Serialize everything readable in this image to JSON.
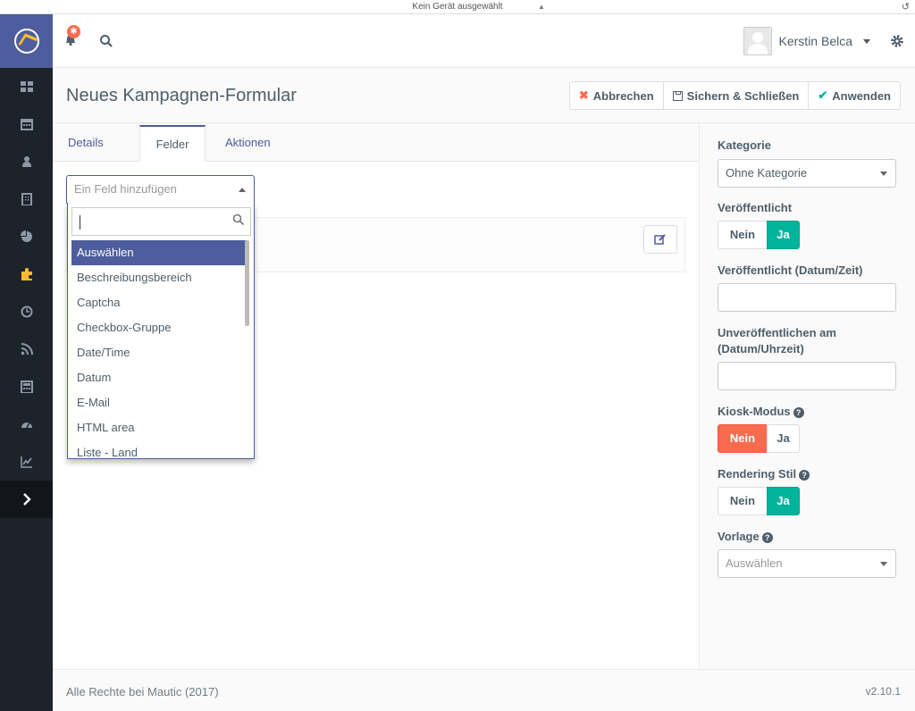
{
  "device_bar": {
    "label": "Kein Gerät ausgewählt"
  },
  "topbar": {
    "user_name": "Kerstin Belca",
    "notification_badge": "✱"
  },
  "header": {
    "title": "Neues Kampagnen-Formular",
    "buttons": {
      "cancel": "Abbrechen",
      "save_close": "Sichern & Schließen",
      "apply": "Anwenden"
    }
  },
  "tabs": {
    "details": "Details",
    "fields": "Felder",
    "actions": "Aktionen"
  },
  "field_select": {
    "placeholder": "Ein Feld hinzufügen",
    "options": [
      "Auswählen",
      "Beschreibungsbereich",
      "Captcha",
      "Checkbox-Gruppe",
      "Date/Time",
      "Datum",
      "E-Mail",
      "HTML area",
      "Liste - Land"
    ],
    "highlighted": "Auswählen"
  },
  "sidebar_panel": {
    "category": {
      "label": "Kategorie",
      "value": "Ohne Kategorie"
    },
    "published": {
      "label": "Veröffentlicht",
      "no": "Nein",
      "yes": "Ja",
      "selected": "Ja"
    },
    "publish_up": {
      "label": "Veröffentlicht (Datum/Zeit)",
      "value": ""
    },
    "publish_down": {
      "label_line1": "Unveröffentlichen am",
      "label_line2": "(Datum/Uhrzeit)",
      "value": ""
    },
    "kiosk": {
      "label": "Kiosk-Modus",
      "no": "Nein",
      "yes": "Ja",
      "selected": "Nein"
    },
    "render_style": {
      "label": "Rendering Stil",
      "no": "Nein",
      "yes": "Ja",
      "selected": "Ja"
    },
    "template": {
      "label": "Vorlage",
      "placeholder": "Auswählen"
    }
  },
  "footer": {
    "copyright": "Alle Rechte bei Mautic (2017)",
    "version": "v2.10.1"
  },
  "colors": {
    "brand": "#4e5d9d",
    "sidebar": "#1d232b",
    "success": "#00b49c",
    "danger": "#f86b4f",
    "accent": "#fdb933"
  },
  "icons": [
    "mautic-logo-icon",
    "dashboard-icon",
    "calendar-icon",
    "contacts-icon",
    "companies-icon",
    "segments-icon",
    "components-icon",
    "campaigns-icon",
    "channels-icon",
    "points-icon",
    "reports-icon",
    "stats-icon",
    "expand-icon",
    "bell-icon",
    "search-icon",
    "gear-icon",
    "edit-icon"
  ]
}
